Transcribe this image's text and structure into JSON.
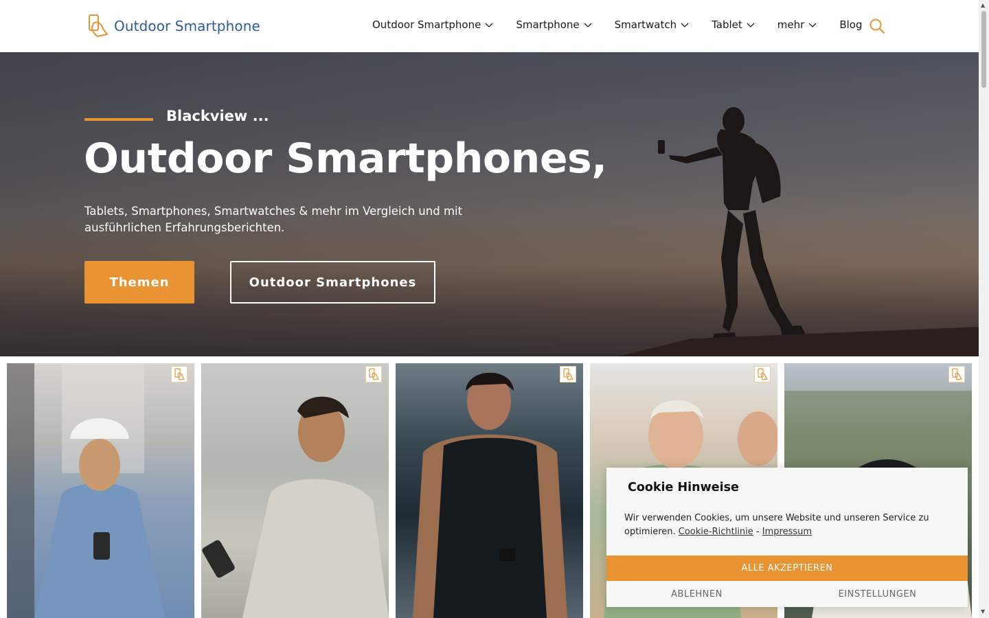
{
  "header": {
    "logo_text": "Outdoor Smartphone",
    "nav": [
      {
        "label": "Outdoor Smartphone",
        "has_dropdown": true
      },
      {
        "label": "Smartphone",
        "has_dropdown": true
      },
      {
        "label": "Smartwatch",
        "has_dropdown": true
      },
      {
        "label": "Tablet",
        "has_dropdown": true
      },
      {
        "label": "mehr",
        "has_dropdown": true
      },
      {
        "label": "Blog",
        "has_dropdown": false
      }
    ],
    "search_icon": "search-icon"
  },
  "hero": {
    "kicker": "Blackview ...",
    "title": "Outdoor Smartphones,",
    "subtitle": "Tablets, Smartphones, Smartwatches & mehr im Vergleich und mit ausführlichen Erfahrungsberichten.",
    "primary_button": "Themen",
    "secondary_button": "Outdoor Smartphones"
  },
  "cards": [
    {
      "badge_icon": "phone-logo-icon"
    },
    {
      "badge_icon": "phone-logo-icon"
    },
    {
      "badge_icon": "phone-logo-icon"
    },
    {
      "badge_icon": "phone-logo-icon"
    },
    {
      "badge_icon": "phone-logo-icon"
    }
  ],
  "cookie": {
    "title": "Cookie Hinweise",
    "text": "Wir verwenden Cookies, um unsere Website und unseren Service zu optimieren.",
    "policy_link": "Cookie-Richtlinie",
    "separator": "-",
    "imprint_link": "Impressum",
    "accept": "ALLE AKZEPTIEREN",
    "decline": "ABLEHNEN",
    "settings": "EINSTELLUNGEN"
  },
  "colors": {
    "accent": "#e99332",
    "logo_blue": "#2d5c9c"
  }
}
